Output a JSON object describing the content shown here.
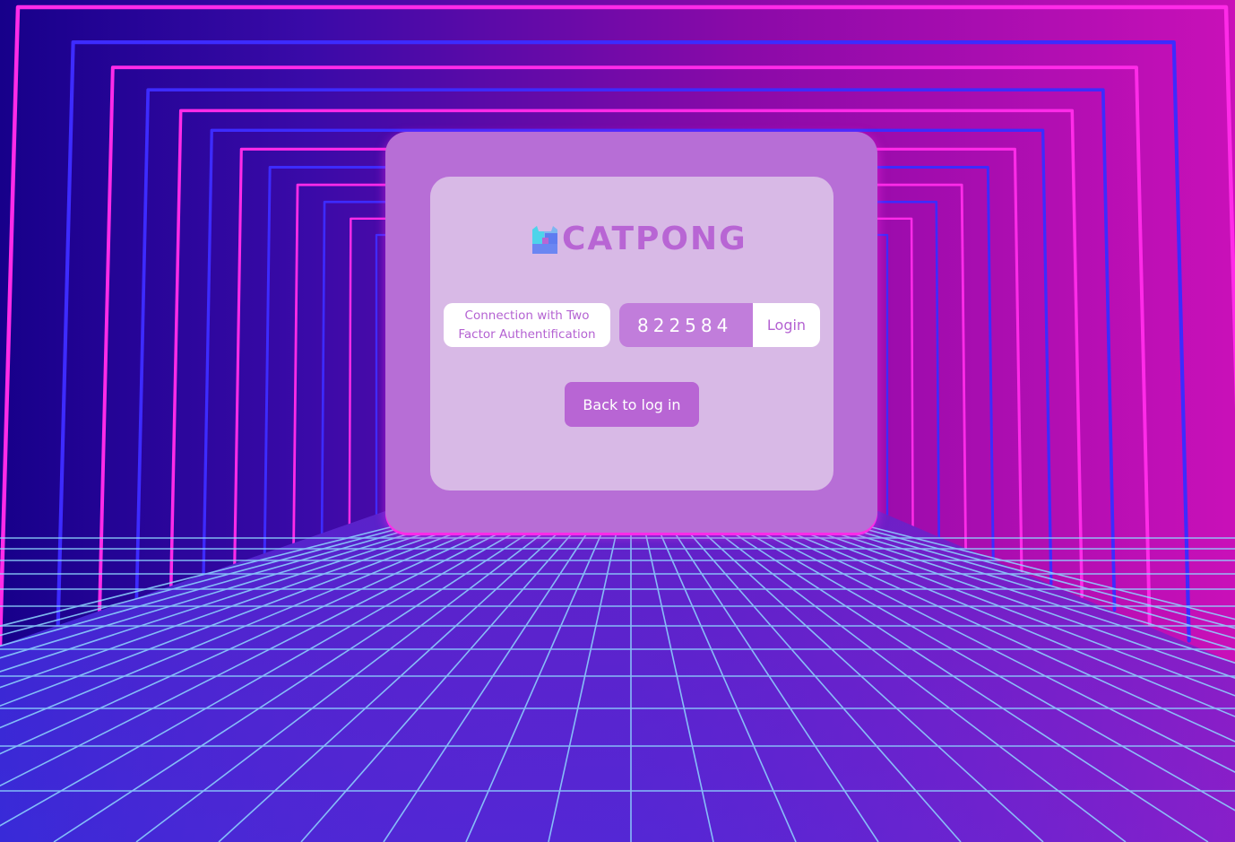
{
  "app": {
    "name": "CATPONG"
  },
  "auth": {
    "two_factor_label": "Connection with Two Factor Authentification",
    "code_value": "822584",
    "login_label": "Login",
    "back_label": "Back to log in"
  },
  "colors": {
    "accent": "#b865d4",
    "card_outer": "#b76ed6",
    "card_inner": "#d8b9e6",
    "neon_pink": "#ff2be8",
    "neon_blue": "#3d2bff",
    "grid_line": "#8fd8ff"
  },
  "icons": {
    "logo": "cat-logo-icon"
  }
}
